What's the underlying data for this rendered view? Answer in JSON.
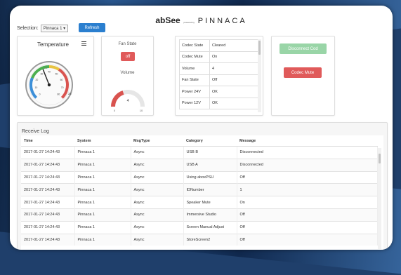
{
  "brand": {
    "name": "abSee",
    "powered": "powered by",
    "company": "PINNACA"
  },
  "selection": {
    "label": "Selection:",
    "value": "Pinnaca 1",
    "refresh_label": "Refresh"
  },
  "temperature": {
    "title": "Temperature",
    "gauge_unit": "°C",
    "gauge_value": 28,
    "gauge_level": 0.42,
    "zone_colors": {
      "cold": "#3c8fd8",
      "ok": "#4caf50",
      "warm": "#e7c341",
      "hot": "#d9534f"
    },
    "ticks": [
      "0",
      "10",
      "20",
      "30",
      "40",
      "50",
      "60",
      "70",
      "80"
    ]
  },
  "fan": {
    "title": "Fan State",
    "button": "off",
    "volume_title": "Volume",
    "volume_value": "4",
    "volume_min": "0",
    "volume_max": "10",
    "volume_level": 0.4
  },
  "codec_table": [
    {
      "key": "Codec State",
      "value": "Cleared"
    },
    {
      "key": "Codec Mute",
      "value": "On"
    },
    {
      "key": "Volume",
      "value": "4"
    },
    {
      "key": "Fan State",
      "value": "Off"
    },
    {
      "key": "Power 24V",
      "value": "OK"
    },
    {
      "key": "Power 12V",
      "value": "OK"
    }
  ],
  "actions": {
    "disconnect_label": "Disconnect Cod",
    "mute_label": "Codec Mute"
  },
  "log": {
    "title": "Receive Log",
    "columns": [
      "Time",
      "System",
      "MsgType",
      "Category",
      "Message"
    ],
    "rows": [
      [
        "2017-01-27 14:24:43",
        "Pinnaca 1",
        "Async",
        "USB B",
        "Disconnected"
      ],
      [
        "2017-01-27 14:24:43",
        "Pinnaca 1",
        "Async",
        "USB A",
        "Disconnected"
      ],
      [
        "2017-01-27 14:24:43",
        "Pinnaca 1",
        "Async",
        "Using aboxPSU",
        "Off"
      ],
      [
        "2017-01-27 14:24:43",
        "Pinnaca 1",
        "Async",
        "IDNumber",
        "1"
      ],
      [
        "2017-01-27 14:24:43",
        "Pinnaca 1",
        "Async",
        "Speaker Mute",
        "On"
      ],
      [
        "2017-01-27 14:24:43",
        "Pinnaca 1",
        "Async",
        "Immersive Studio",
        "Off"
      ],
      [
        "2017-01-27 14:24:43",
        "Pinnaca 1",
        "Async",
        "Screen Manual Adjust",
        "Off"
      ],
      [
        "2017-01-27 14:24:43",
        "Pinnaca 1",
        "Async",
        "StoreScreen2",
        "Off"
      ]
    ]
  }
}
